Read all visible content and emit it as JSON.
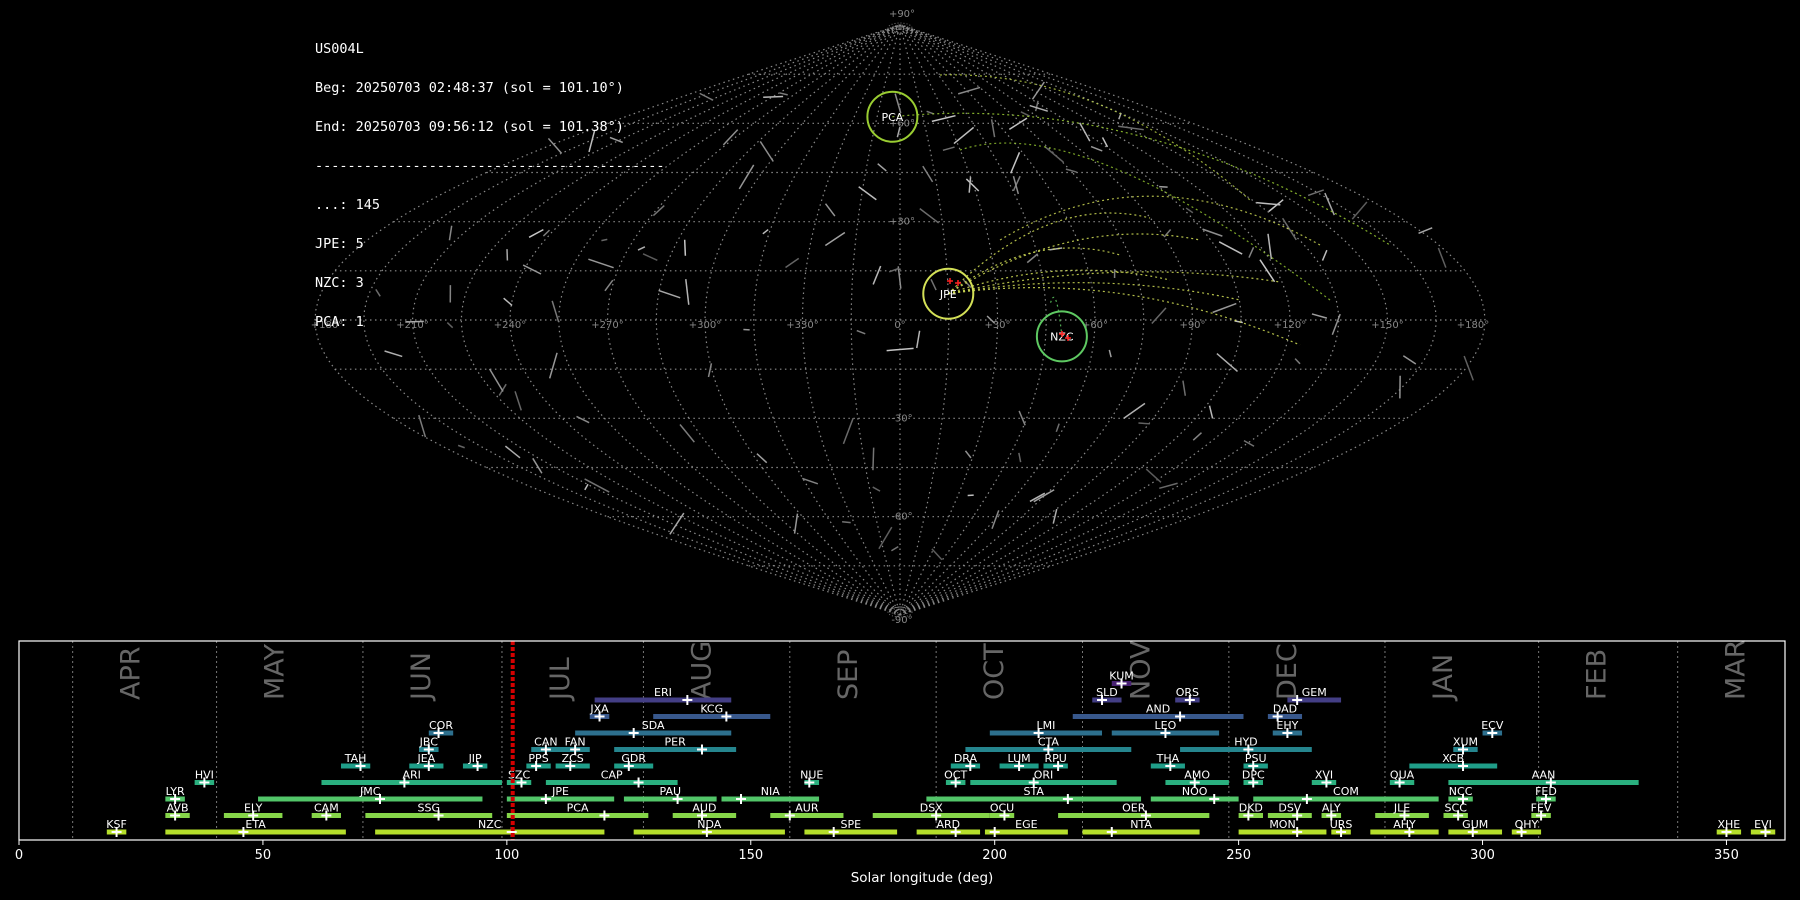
{
  "header": {
    "station": "US004L",
    "beg": "Beg: 20250703 02:48:37 (sol = 101.10°)",
    "end": "End: 20250703 09:56:12 (sol = 101.38°)",
    "divider": "-------------------------------------------",
    "counts": [
      {
        "label": "...: 145"
      },
      {
        "label": "JPE: 5"
      },
      {
        "label": "NZC: 3"
      },
      {
        "label": "PCA: 1"
      }
    ]
  },
  "sky_map": {
    "lon_labels": [
      "+180°",
      "+150°",
      "+120°",
      "+90°",
      "+60°",
      "+30°",
      "0°",
      "+330°",
      "+300°",
      "+270°",
      "+240°",
      "+210°",
      "+180°"
    ],
    "lat_labels": [
      "+90°",
      "+60°",
      "+30°",
      "-30°",
      "-60°",
      "-90°"
    ],
    "showers": [
      {
        "code": "PCA",
        "lon": 5,
        "lat": 62,
        "color": "#9acd32",
        "r": 25
      },
      {
        "code": "JPE",
        "lon": 345,
        "lat": 8,
        "color": "#d4e157",
        "r": 25
      },
      {
        "code": "NZC",
        "lon": 310,
        "lat": -5,
        "color": "#5ec962",
        "r": 25
      }
    ]
  },
  "chart_data": {
    "type": "timeline",
    "xlabel": "Solar longitude (deg)",
    "xlim": [
      0,
      362
    ],
    "xticks": [
      0,
      50,
      100,
      150,
      200,
      250,
      300,
      350
    ],
    "current_sol": 101.2,
    "months": [
      {
        "label": "APR",
        "start": 11
      },
      {
        "label": "MAY",
        "start": 40.5
      },
      {
        "label": "JUN",
        "start": 70.5
      },
      {
        "label": "JUL",
        "start": 99
      },
      {
        "label": "AUG",
        "start": 128
      },
      {
        "label": "SEP",
        "start": 158
      },
      {
        "label": "OCT",
        "start": 188
      },
      {
        "label": "NOV",
        "start": 218
      },
      {
        "label": "DEC",
        "start": 248
      },
      {
        "label": "JAN",
        "start": 280
      },
      {
        "label": "FEB",
        "start": 311.5
      },
      {
        "label": "MAR",
        "start": 340
      }
    ],
    "showers": [
      {
        "code": "KSF",
        "start": 18,
        "end": 22,
        "peak": 20,
        "row": 0
      },
      {
        "code": "ETA",
        "start": 30,
        "end": 67,
        "peak": 46,
        "row": 0
      },
      {
        "code": "NZC",
        "start": 73,
        "end": 120,
        "peak": 101,
        "row": 0
      },
      {
        "code": "NDA",
        "start": 126,
        "end": 157,
        "peak": 141,
        "row": 0
      },
      {
        "code": "SPE",
        "start": 161,
        "end": 180,
        "peak": 167,
        "row": 0
      },
      {
        "code": "ARD",
        "start": 184,
        "end": 197,
        "peak": 192,
        "row": 0
      },
      {
        "code": "EGE",
        "start": 198,
        "end": 215,
        "peak": 200,
        "row": 0
      },
      {
        "code": "NTA",
        "start": 218,
        "end": 242,
        "peak": 224,
        "row": 0
      },
      {
        "code": "MON",
        "start": 250,
        "end": 268,
        "peak": 262,
        "row": 0
      },
      {
        "code": "URS",
        "start": 269,
        "end": 273,
        "peak": 271,
        "row": 0
      },
      {
        "code": "AHY",
        "start": 277,
        "end": 291,
        "peak": 285,
        "row": 0
      },
      {
        "code": "GUM",
        "start": 293,
        "end": 304,
        "peak": 298,
        "row": 0
      },
      {
        "code": "QHY",
        "start": 306,
        "end": 312,
        "peak": 308,
        "row": 0
      },
      {
        "code": "XHE",
        "start": 348,
        "end": 353,
        "peak": 350,
        "row": 0
      },
      {
        "code": "EVI",
        "start": 355,
        "end": 360,
        "peak": 358,
        "row": 0
      },
      {
        "code": "AVB",
        "start": 30,
        "end": 35,
        "peak": 32,
        "row": 1
      },
      {
        "code": "ELY",
        "start": 42,
        "end": 54,
        "peak": 48,
        "row": 1
      },
      {
        "code": "CAM",
        "start": 60,
        "end": 66,
        "peak": 63,
        "row": 1
      },
      {
        "code": "SSG",
        "start": 71,
        "end": 97,
        "peak": 86,
        "row": 1
      },
      {
        "code": "PCA",
        "start": 100,
        "end": 129,
        "peak": 120,
        "row": 1
      },
      {
        "code": "AUD",
        "start": 134,
        "end": 147,
        "peak": 140,
        "row": 1
      },
      {
        "code": "AUR",
        "start": 154,
        "end": 169,
        "peak": 158,
        "row": 1
      },
      {
        "code": "DSX",
        "start": 175,
        "end": 199,
        "peak": 188,
        "row": 1
      },
      {
        "code": "OCU",
        "start": 199,
        "end": 204,
        "peak": 202,
        "row": 1
      },
      {
        "code": "OER",
        "start": 213,
        "end": 244,
        "peak": 231,
        "row": 1
      },
      {
        "code": "DKD",
        "start": 250,
        "end": 255,
        "peak": 252,
        "row": 1
      },
      {
        "code": "DSV",
        "start": 256,
        "end": 265,
        "peak": 262,
        "row": 1
      },
      {
        "code": "ALY",
        "start": 267,
        "end": 271,
        "peak": 269,
        "row": 1
      },
      {
        "code": "JLE",
        "start": 278,
        "end": 289,
        "peak": 284,
        "row": 1
      },
      {
        "code": "SCC",
        "start": 292,
        "end": 297,
        "peak": 295,
        "row": 1
      },
      {
        "code": "FEV",
        "start": 310,
        "end": 314,
        "peak": 312,
        "row": 1
      },
      {
        "code": "LYR",
        "start": 30,
        "end": 34,
        "peak": 32,
        "row": 2
      },
      {
        "code": "JMC",
        "start": 49,
        "end": 95,
        "peak": 74,
        "row": 2
      },
      {
        "code": "JPE",
        "start": 100,
        "end": 122,
        "peak": 108,
        "row": 2
      },
      {
        "code": "PAU",
        "start": 124,
        "end": 143,
        "peak": 135,
        "row": 2
      },
      {
        "code": "NIA",
        "start": 144,
        "end": 164,
        "peak": 148,
        "row": 2
      },
      {
        "code": "STA",
        "start": 186,
        "end": 230,
        "peak": 215,
        "row": 2
      },
      {
        "code": "NOO",
        "start": 232,
        "end": 250,
        "peak": 245,
        "row": 2
      },
      {
        "code": "COM",
        "start": 253,
        "end": 291,
        "peak": 264,
        "row": 2
      },
      {
        "code": "NCC",
        "start": 293,
        "end": 298,
        "peak": 296,
        "row": 2
      },
      {
        "code": "FED",
        "start": 311,
        "end": 315,
        "peak": 313,
        "row": 2
      },
      {
        "code": "HVI",
        "start": 36,
        "end": 40,
        "peak": 38,
        "row": 3
      },
      {
        "code": "ARI",
        "start": 62,
        "end": 99,
        "peak": 79,
        "row": 3
      },
      {
        "code": "SZC",
        "start": 100,
        "end": 105,
        "peak": 103,
        "row": 3
      },
      {
        "code": "CAP",
        "start": 108,
        "end": 135,
        "peak": 127,
        "row": 3
      },
      {
        "code": "NUE",
        "start": 161,
        "end": 164,
        "peak": 162,
        "row": 3
      },
      {
        "code": "OCT",
        "start": 190,
        "end": 194,
        "peak": 192,
        "row": 3
      },
      {
        "code": "ORI",
        "start": 195,
        "end": 225,
        "peak": 208,
        "row": 3
      },
      {
        "code": "AMO",
        "start": 235,
        "end": 248,
        "peak": 241,
        "row": 3
      },
      {
        "code": "DPC",
        "start": 251,
        "end": 255,
        "peak": 253,
        "row": 3
      },
      {
        "code": "XVI",
        "start": 265,
        "end": 270,
        "peak": 268,
        "row": 3
      },
      {
        "code": "QUA",
        "start": 281,
        "end": 286,
        "peak": 283,
        "row": 3
      },
      {
        "code": "AAN",
        "start": 293,
        "end": 332,
        "peak": 314,
        "row": 3
      },
      {
        "code": "TAH",
        "start": 66,
        "end": 72,
        "peak": 70,
        "row": 4
      },
      {
        "code": "JEA",
        "start": 80,
        "end": 87,
        "peak": 84,
        "row": 4
      },
      {
        "code": "JIP",
        "start": 91,
        "end": 96,
        "peak": 94,
        "row": 4
      },
      {
        "code": "PPS",
        "start": 104,
        "end": 109,
        "peak": 106,
        "row": 4
      },
      {
        "code": "ZCS",
        "start": 110,
        "end": 117,
        "peak": 113,
        "row": 4
      },
      {
        "code": "GDR",
        "start": 122,
        "end": 130,
        "peak": 125,
        "row": 4
      },
      {
        "code": "DRA",
        "start": 191,
        "end": 197,
        "peak": 195,
        "row": 4
      },
      {
        "code": "LUM",
        "start": 201,
        "end": 209,
        "peak": 205,
        "row": 4
      },
      {
        "code": "RPU",
        "start": 210,
        "end": 215,
        "peak": 213,
        "row": 4
      },
      {
        "code": "THA",
        "start": 232,
        "end": 239,
        "peak": 236,
        "row": 4
      },
      {
        "code": "PSU",
        "start": 251,
        "end": 256,
        "peak": 253,
        "row": 4
      },
      {
        "code": "XCB",
        "start": 285,
        "end": 303,
        "peak": 296,
        "row": 4
      },
      {
        "code": "JBC",
        "start": 82,
        "end": 86,
        "peak": 84,
        "row": 5
      },
      {
        "code": "CAN",
        "start": 105,
        "end": 111,
        "peak": 108,
        "row": 5
      },
      {
        "code": "FAN",
        "start": 111,
        "end": 117,
        "peak": 114,
        "row": 5
      },
      {
        "code": "PER",
        "start": 122,
        "end": 147,
        "peak": 140,
        "row": 5
      },
      {
        "code": "CTA",
        "start": 194,
        "end": 228,
        "peak": 211,
        "row": 5
      },
      {
        "code": "HYD",
        "start": 238,
        "end": 265,
        "peak": 252,
        "row": 5
      },
      {
        "code": "XUM",
        "start": 294,
        "end": 299,
        "peak": 296,
        "row": 5
      },
      {
        "code": "COR",
        "start": 84,
        "end": 89,
        "peak": 86,
        "row": 6
      },
      {
        "code": "SDA",
        "start": 114,
        "end": 146,
        "peak": 126,
        "row": 6
      },
      {
        "code": "LMI",
        "start": 199,
        "end": 222,
        "peak": 209,
        "row": 6
      },
      {
        "code": "LEO",
        "start": 224,
        "end": 246,
        "peak": 235,
        "row": 6
      },
      {
        "code": "EHY",
        "start": 257,
        "end": 263,
        "peak": 260,
        "row": 6
      },
      {
        "code": "ECV",
        "start": 300,
        "end": 304,
        "peak": 302,
        "row": 6
      },
      {
        "code": "JXA",
        "start": 117,
        "end": 121,
        "peak": 119,
        "row": 7
      },
      {
        "code": "KCG",
        "start": 130,
        "end": 154,
        "peak": 145,
        "row": 7
      },
      {
        "code": "AND",
        "start": 216,
        "end": 251,
        "peak": 238,
        "row": 7
      },
      {
        "code": "DAD",
        "start": 256,
        "end": 263,
        "peak": 258,
        "row": 7
      },
      {
        "code": "ERI",
        "start": 118,
        "end": 146,
        "peak": 137,
        "row": 8
      },
      {
        "code": "SLD",
        "start": 220,
        "end": 226,
        "peak": 222,
        "row": 8
      },
      {
        "code": "ORS",
        "start": 237,
        "end": 242,
        "peak": 240,
        "row": 8
      },
      {
        "code": "GEM",
        "start": 260,
        "end": 271,
        "peak": 262,
        "row": 8
      },
      {
        "code": "KUM",
        "start": 224,
        "end": 228,
        "peak": 226,
        "row": 9
      }
    ],
    "row_colors": [
      "#b5de2b",
      "#86d549",
      "#52c569",
      "#2ab07f",
      "#1f9e89",
      "#25858e",
      "#2d708e",
      "#38588c",
      "#433e85",
      "#482173"
    ]
  }
}
